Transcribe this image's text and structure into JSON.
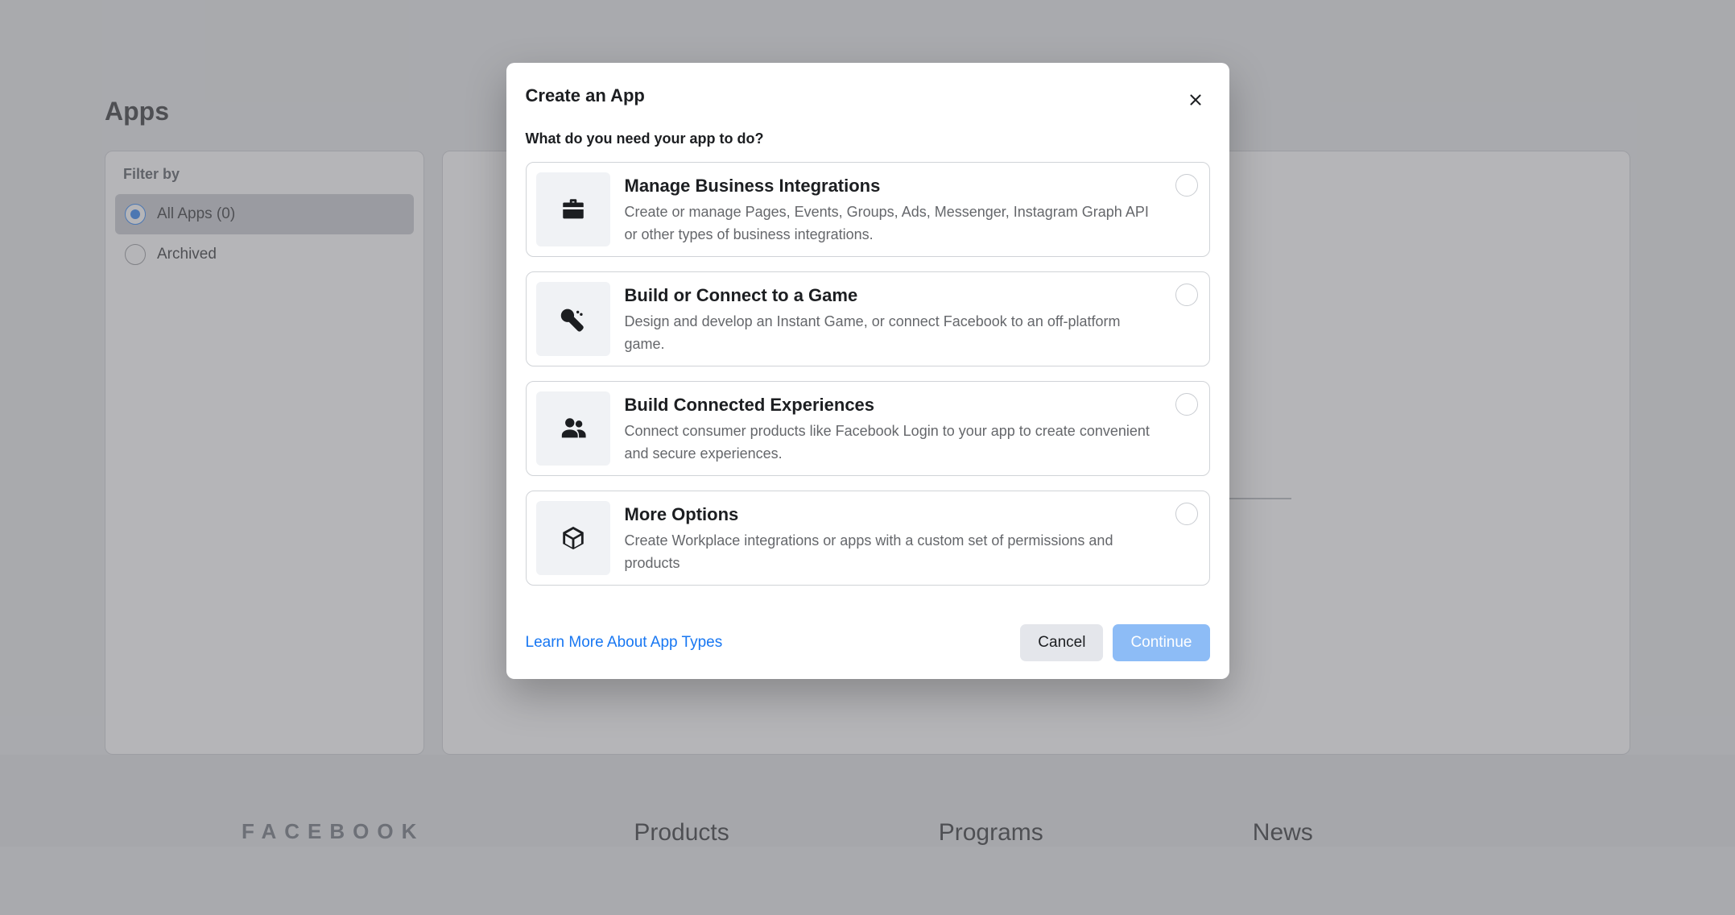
{
  "page": {
    "title": "Apps"
  },
  "sidebar": {
    "heading": "Filter by",
    "items": [
      {
        "label": "All Apps (0)",
        "selected": true
      },
      {
        "label": "Archived",
        "selected": false
      }
    ]
  },
  "footer": {
    "logo": "FACEBOOK",
    "columns": [
      {
        "title": "Products"
      },
      {
        "title": "Programs"
      },
      {
        "title": "News"
      }
    ]
  },
  "modal": {
    "title": "Create an App",
    "subtitle": "What do you need your app to do?",
    "options": [
      {
        "icon": "briefcase",
        "title": "Manage Business Integrations",
        "description": "Create or manage Pages, Events, Groups, Ads, Messenger, Instagram Graph API or other types of business integrations."
      },
      {
        "icon": "game",
        "title": "Build or Connect to a Game",
        "description": "Design and develop an Instant Game, or connect Facebook to an off-platform game."
      },
      {
        "icon": "users",
        "title": "Build Connected Experiences",
        "description": "Connect consumer products like Facebook Login to your app to create convenient and secure experiences."
      },
      {
        "icon": "box",
        "title": "More Options",
        "description": "Create Workplace integrations or apps with a custom set of permissions and products"
      }
    ],
    "learn_link": "Learn More About App Types",
    "cancel_label": "Cancel",
    "continue_label": "Continue"
  }
}
